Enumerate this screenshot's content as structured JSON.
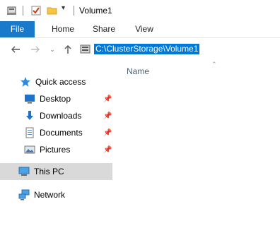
{
  "window": {
    "title": "Volume1"
  },
  "ribbon": {
    "tabs": [
      "File",
      "Home",
      "Share",
      "View"
    ]
  },
  "address": {
    "path": "C:\\ClusterStorage\\Volume1"
  },
  "content": {
    "column_name": "Name"
  },
  "nav": {
    "quick_access": "Quick access",
    "items": [
      {
        "label": "Desktop",
        "icon": "desktop-icon",
        "pinned": true
      },
      {
        "label": "Downloads",
        "icon": "downloads-icon",
        "pinned": true
      },
      {
        "label": "Documents",
        "icon": "documents-icon",
        "pinned": true
      },
      {
        "label": "Pictures",
        "icon": "pictures-icon",
        "pinned": true
      }
    ],
    "this_pc": "This PC",
    "network": "Network"
  },
  "colors": {
    "file_tab": "#1979ca",
    "selection": "#0078d7",
    "selected_nav": "#d9d9d9"
  }
}
